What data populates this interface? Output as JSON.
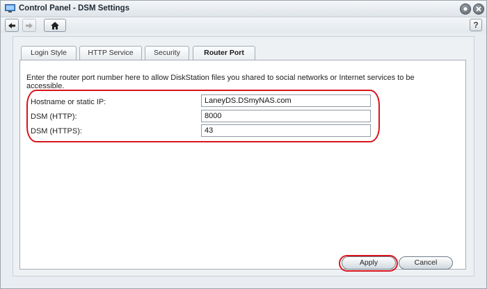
{
  "window": {
    "title": "Control Panel - DSM Settings",
    "help_label": "?"
  },
  "icons": {
    "app": "control-panel-icon",
    "back": "arrow-left-icon",
    "forward": "arrow-right-icon",
    "home": "home-icon",
    "minimize": "pin-icon",
    "close": "close-icon"
  },
  "tabs": [
    {
      "label": "Login Style",
      "active": false
    },
    {
      "label": "HTTP Service",
      "active": false
    },
    {
      "label": "Security",
      "active": false
    },
    {
      "label": "Router Port",
      "active": true
    }
  ],
  "panel": {
    "intro": "Enter the router port number here to allow DiskStation files you shared to social networks or Internet services to be accessible.",
    "fields": [
      {
        "label": "Hostname or static IP:",
        "value": "LaneyDS.DSmyNAS.com"
      },
      {
        "label": "DSM (HTTP):",
        "value": "8000"
      },
      {
        "label": "DSM (HTTPS):",
        "value": "43"
      }
    ]
  },
  "footer": {
    "apply_label": "Apply",
    "cancel_label": "Cancel"
  },
  "colors": {
    "highlight": "#d8141a",
    "window_bg": "#e9edf1"
  }
}
